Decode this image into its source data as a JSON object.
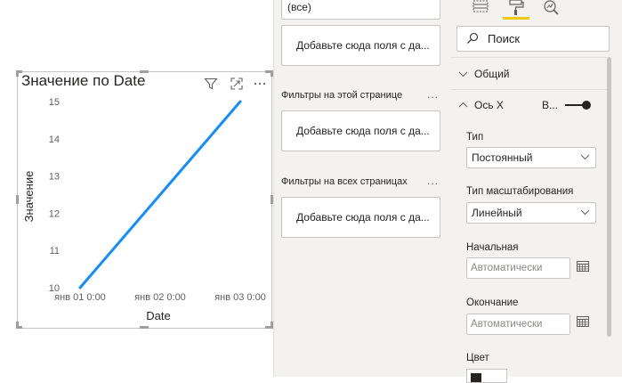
{
  "visual": {
    "title": "Значение по Date"
  },
  "chart_data": {
    "type": "line",
    "title": "Значение по Date",
    "xlabel": "Date",
    "ylabel": "Значение",
    "x": [
      "янв 01 0:00",
      "янв 02 0:00",
      "янв 03 0:00"
    ],
    "series": [
      {
        "values": [
          10,
          12.5,
          15
        ]
      }
    ],
    "ylim": [
      10,
      15
    ],
    "yticks": [
      10,
      11,
      12,
      13,
      14,
      15
    ],
    "grid": false,
    "line_color": "#118dff"
  },
  "filters": {
    "top_value": "(все)",
    "add_field_visual": "Добавьте сюда поля с да...",
    "page_header": "Фильтры на этой странице",
    "add_field_page": "Добавьте сюда поля с да...",
    "all_pages_header": "Фильтры на всех страницах",
    "add_field_all": "Добавьте сюда поля с да...",
    "more": "..."
  },
  "format": {
    "search_placeholder": "Поиск",
    "general": "Общий",
    "x_axis": "Ось X",
    "x_axis_toggle_text": "В...",
    "type_label": "Тип",
    "type_value": "Постоянный",
    "scale_label": "Тип масштабирования",
    "scale_value": "Линейный",
    "start_label": "Начальная",
    "start_placeholder": "Автоматически",
    "end_label": "Окончание",
    "end_placeholder": "Автоматически",
    "color_label": "Цвет"
  },
  "colors": {
    "accent_yellow": "#f2c811",
    "line_blue": "#118dff",
    "pane_bg": "#f3f2f1"
  }
}
